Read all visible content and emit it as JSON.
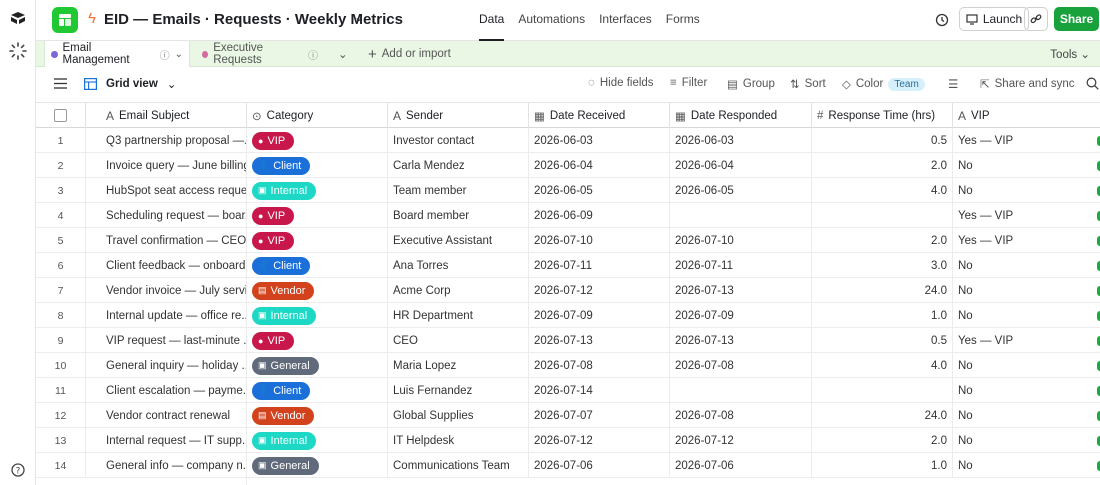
{
  "base": {
    "title": "EID — Emails · Requests · Weekly Metrics"
  },
  "nav": {
    "tabs": [
      "Data",
      "Automations",
      "Interfaces",
      "Forms"
    ],
    "active": "Data"
  },
  "actions": {
    "launch": "Launch",
    "share": "Share"
  },
  "tables": {
    "tab1": "Email Management",
    "tab2": "Executive Requests",
    "add": "Add or import",
    "tools": "Tools"
  },
  "view": {
    "name": "Grid view",
    "hide_fields": "Hide fields",
    "filter": "Filter",
    "group": "Group",
    "sort": "Sort",
    "color": "Color",
    "color_chip": "Team",
    "share_sync": "Share and sync"
  },
  "columns": {
    "subject": "Email Subject",
    "category": "Category",
    "sender": "Sender",
    "received": "Date Received",
    "responded": "Date Responded",
    "response_time": "Response Time (hrs)",
    "vip": "VIP"
  },
  "category_colors": {
    "VIP": "#c8174b",
    "Client": "#1b6fd8",
    "Internal": "#1dd8c4",
    "Vendor": "#d2431d",
    "General": "#606a7a"
  },
  "accent": "#20c933",
  "rows": [
    {
      "n": "1",
      "subject": "Q3 partnership proposal —...",
      "category": "VIP",
      "sender": "Investor contact",
      "received": "2026-06-03",
      "responded": "2026-06-03",
      "hrs": "0.5",
      "vip": "Yes — VIP"
    },
    {
      "n": "2",
      "subject": "Invoice query — June billing",
      "category": "Client",
      "sender": "Carla Mendez",
      "received": "2026-06-04",
      "responded": "2026-06-04",
      "hrs": "2.0",
      "vip": "No"
    },
    {
      "n": "3",
      "subject": "HubSpot seat access request",
      "category": "Internal",
      "sender": "Team member",
      "received": "2026-06-05",
      "responded": "2026-06-05",
      "hrs": "4.0",
      "vip": "No"
    },
    {
      "n": "4",
      "subject": "Scheduling request — boar...",
      "category": "VIP",
      "sender": "Board member",
      "received": "2026-06-09",
      "responded": "",
      "hrs": "",
      "vip": "Yes — VIP"
    },
    {
      "n": "5",
      "subject": "Travel confirmation — CEO...",
      "category": "VIP",
      "sender": "Executive Assistant",
      "received": "2026-07-10",
      "responded": "2026-07-10",
      "hrs": "2.0",
      "vip": "Yes — VIP"
    },
    {
      "n": "6",
      "subject": "Client feedback — onboard...",
      "category": "Client",
      "sender": "Ana Torres",
      "received": "2026-07-11",
      "responded": "2026-07-11",
      "hrs": "3.0",
      "vip": "No"
    },
    {
      "n": "7",
      "subject": "Vendor invoice — July servi...",
      "category": "Vendor",
      "sender": "Acme Corp",
      "received": "2026-07-12",
      "responded": "2026-07-13",
      "hrs": "24.0",
      "vip": "No"
    },
    {
      "n": "8",
      "subject": "Internal update — office re...",
      "category": "Internal",
      "sender": "HR Department",
      "received": "2026-07-09",
      "responded": "2026-07-09",
      "hrs": "1.0",
      "vip": "No"
    },
    {
      "n": "9",
      "subject": "VIP request — last-minute ...",
      "category": "VIP",
      "sender": "CEO",
      "received": "2026-07-13",
      "responded": "2026-07-13",
      "hrs": "0.5",
      "vip": "Yes — VIP"
    },
    {
      "n": "10",
      "subject": "General inquiry — holiday ...",
      "category": "General",
      "sender": "Maria Lopez",
      "received": "2026-07-08",
      "responded": "2026-07-08",
      "hrs": "4.0",
      "vip": "No"
    },
    {
      "n": "11",
      "subject": "Client escalation — payme...",
      "category": "Client",
      "sender": "Luis Fernandez",
      "received": "2026-07-14",
      "responded": "",
      "hrs": "",
      "vip": "No"
    },
    {
      "n": "12",
      "subject": "Vendor contract renewal",
      "category": "Vendor",
      "sender": "Global Supplies",
      "received": "2026-07-07",
      "responded": "2026-07-08",
      "hrs": "24.0",
      "vip": "No"
    },
    {
      "n": "13",
      "subject": "Internal request — IT supp...",
      "category": "Internal",
      "sender": "IT Helpdesk",
      "received": "2026-07-12",
      "responded": "2026-07-12",
      "hrs": "2.0",
      "vip": "No"
    },
    {
      "n": "14",
      "subject": "General info — company n...",
      "category": "General",
      "sender": "Communications Team",
      "received": "2026-07-06",
      "responded": "2026-07-06",
      "hrs": "1.0",
      "vip": "No"
    }
  ]
}
